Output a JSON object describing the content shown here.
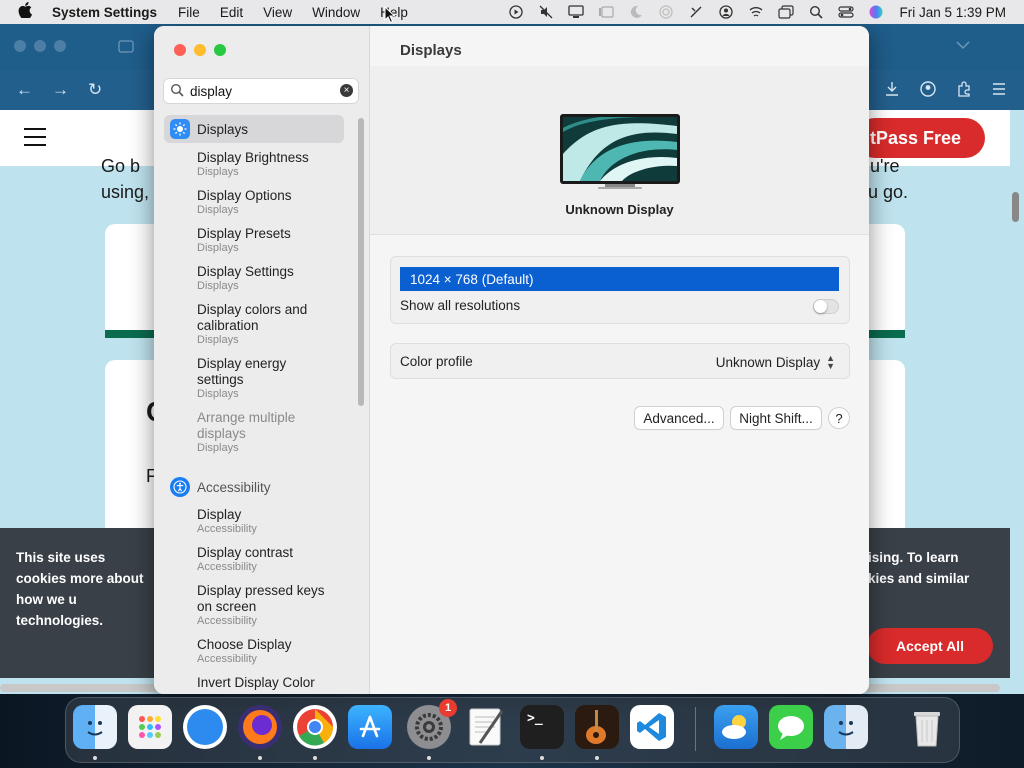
{
  "menubar": {
    "app_name": "System Settings",
    "menus": [
      "File",
      "Edit",
      "View",
      "Window",
      "Help"
    ],
    "clock": "Fri Jan 5  1:39 PM"
  },
  "browser": {
    "trial_button": "tPass Free",
    "bg_text_line1_left": "Go b",
    "bg_text_line1_right": "u're",
    "bg_text_line2_left": "using,",
    "bg_text_line2_right": "u go.",
    "card_letter_1": "C",
    "card_letter_2": "F",
    "cookie_left": "This site uses cookies more about how we u technologies.",
    "cookie_right": "ising. To learn kies and similar",
    "accept_button": "Accept All"
  },
  "settings": {
    "search": {
      "value": "display"
    },
    "sidebar": {
      "categories": [
        {
          "label": "Displays"
        },
        {
          "label": "Accessibility"
        }
      ],
      "display_results": [
        {
          "title": "Display Brightness",
          "sub": "Displays"
        },
        {
          "title": "Display Options",
          "sub": "Displays"
        },
        {
          "title": "Display Presets",
          "sub": "Displays"
        },
        {
          "title": "Display Settings",
          "sub": "Displays"
        },
        {
          "title": "Display colors and calibration",
          "sub": "Displays"
        },
        {
          "title": "Display energy settings",
          "sub": "Displays"
        },
        {
          "title": "Arrange multiple displays",
          "sub": "Displays"
        }
      ],
      "accessibility_results": [
        {
          "title": "Display",
          "sub": "Accessibility"
        },
        {
          "title": "Display contrast",
          "sub": "Accessibility"
        },
        {
          "title": "Display pressed keys on screen",
          "sub": "Accessibility"
        },
        {
          "title": "Choose Display",
          "sub": "Accessibility"
        },
        {
          "title": "Invert Display Color",
          "sub": ""
        }
      ]
    },
    "content": {
      "title": "Displays",
      "display_name": "Unknown Display",
      "resolution": "1024 × 768 (Default)",
      "show_all_resolutions": "Show all resolutions",
      "show_all_resolutions_on": false,
      "color_profile_label": "Color profile",
      "color_profile_value": "Unknown Display",
      "advanced_button": "Advanced...",
      "night_shift_button": "Night Shift...",
      "help_button": "?"
    }
  },
  "dock": {
    "settings_badge": "1"
  },
  "colors": {
    "accent": "#0a5fd1",
    "cta_red": "#d92b2b",
    "close": "#fe5f57",
    "minimize": "#febc2e",
    "zoom": "#28c840"
  }
}
